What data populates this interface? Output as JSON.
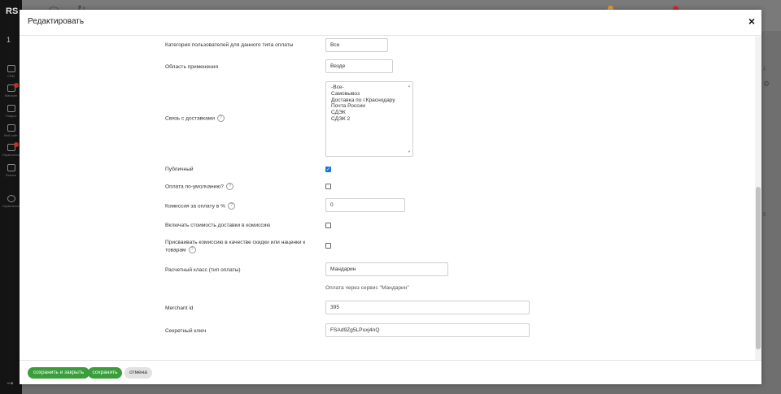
{
  "background": {
    "logo": "RS",
    "counter": "1",
    "sidebar_items": [
      "CRM",
      "Магазин",
      "Товары",
      "Веб-сайт",
      "Управление",
      "Разное",
      "Управление"
    ],
    "right_texts": [
      "1",
      "5"
    ]
  },
  "modal": {
    "title": "Редактировать",
    "close_label": "×"
  },
  "form": {
    "user_category": {
      "label": "Категория пользователей для данного типа оплаты",
      "value": "Все"
    },
    "scope": {
      "label": "Область применения",
      "value": "Везде"
    },
    "delivery_link": {
      "label": "Связь с доставками",
      "help": "?",
      "options": [
        "-Все-",
        "Самовывоз",
        "Доставка по г.Краснодару",
        "Почта России",
        "СДЭК",
        "СДЭК 2"
      ]
    },
    "public": {
      "label": "Публичный",
      "checked": true
    },
    "default_payment": {
      "label": "Оплата по-умолчанию?",
      "help": "?",
      "checked": false
    },
    "commission": {
      "label": "Комиссия за оплату в %",
      "help": "?",
      "value": "0"
    },
    "include_delivery": {
      "label": "Включать стоимость доставки в комиссию",
      "checked": false
    },
    "assign_commission": {
      "label_line1": "Присваивать комиссию в качестве скидки или наценки к",
      "label_line2": "товарам",
      "help": "?",
      "checked": false
    },
    "calc_class": {
      "label": "Расчетный класс (тип оплаты)",
      "value": "Мандарин",
      "note": "Оплата через сервис \"Мандарин\""
    },
    "merchant_id": {
      "label": "Merchant id",
      "value": "395"
    },
    "secret_key": {
      "label": "Секретный ключ",
      "value": "FSAd9Zg5LPuxj4nQ"
    }
  },
  "footer": {
    "save_close": "сохранить и закрыть",
    "save": "сохранить",
    "cancel": "отмена"
  },
  "colors": {
    "accent_green": "#3a9f3a",
    "checkbox_blue": "#1a73e8"
  }
}
